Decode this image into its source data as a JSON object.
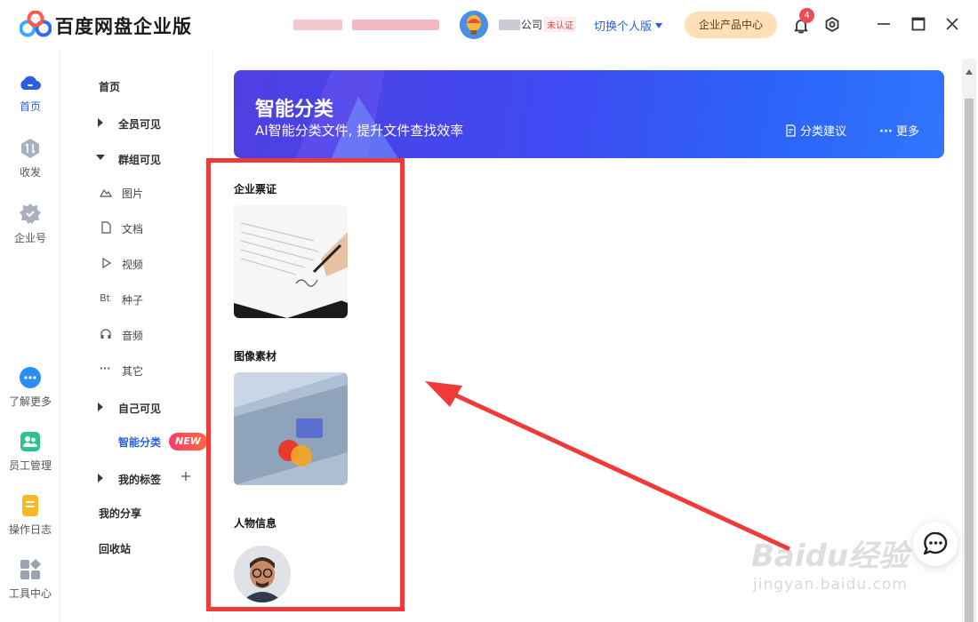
{
  "app": {
    "title": "百度网盘企业版"
  },
  "header": {
    "org_name": "公司",
    "unverified": "未认证",
    "switch_label": "切换个人版",
    "product_center": "企业产品中心",
    "notification_count": "4",
    "colors": {
      "accent": "#2c5fe0",
      "badge": "#f04b55"
    }
  },
  "rail": {
    "items": [
      {
        "label": "首页",
        "icon": "cloud-icon",
        "active": true
      },
      {
        "label": "收发",
        "icon": "transfer-icon"
      },
      {
        "label": "企业号",
        "icon": "enterprise-icon"
      },
      {
        "label": "了解更多",
        "icon": "more-icon"
      },
      {
        "label": "员工管理",
        "icon": "staff-icon"
      },
      {
        "label": "操作日志",
        "icon": "log-icon"
      },
      {
        "label": "工具中心",
        "icon": "tools-icon"
      }
    ]
  },
  "nav": {
    "home": "首页",
    "all_visible": "全员可见",
    "group_visible": "群组可见",
    "group_items": [
      {
        "label": "图片",
        "icon": "image-icon"
      },
      {
        "label": "文档",
        "icon": "doc-icon"
      },
      {
        "label": "视频",
        "icon": "video-icon"
      },
      {
        "label": "种子",
        "icon": "torrent-icon",
        "glyph": "Bt"
      },
      {
        "label": "音频",
        "icon": "audio-icon"
      },
      {
        "label": "其它",
        "icon": "other-icon",
        "glyph": "···"
      }
    ],
    "self_visible": "自己可见",
    "smart_category": "智能分类",
    "new_badge": "NEW",
    "my_tags": "我的标签",
    "my_share": "我的分享",
    "recycle": "回收站"
  },
  "banner": {
    "title": "智能分类",
    "subtitle": "AI智能分类文件, 提升文件查找效率",
    "suggest": "分类建议",
    "more": "更多"
  },
  "sections": [
    {
      "title": "企业票证"
    },
    {
      "title": "图像素材"
    },
    {
      "title": "人物信息"
    }
  ],
  "watermark": {
    "brand": "Baidu经验",
    "url": "jingyan.baidu.com"
  }
}
